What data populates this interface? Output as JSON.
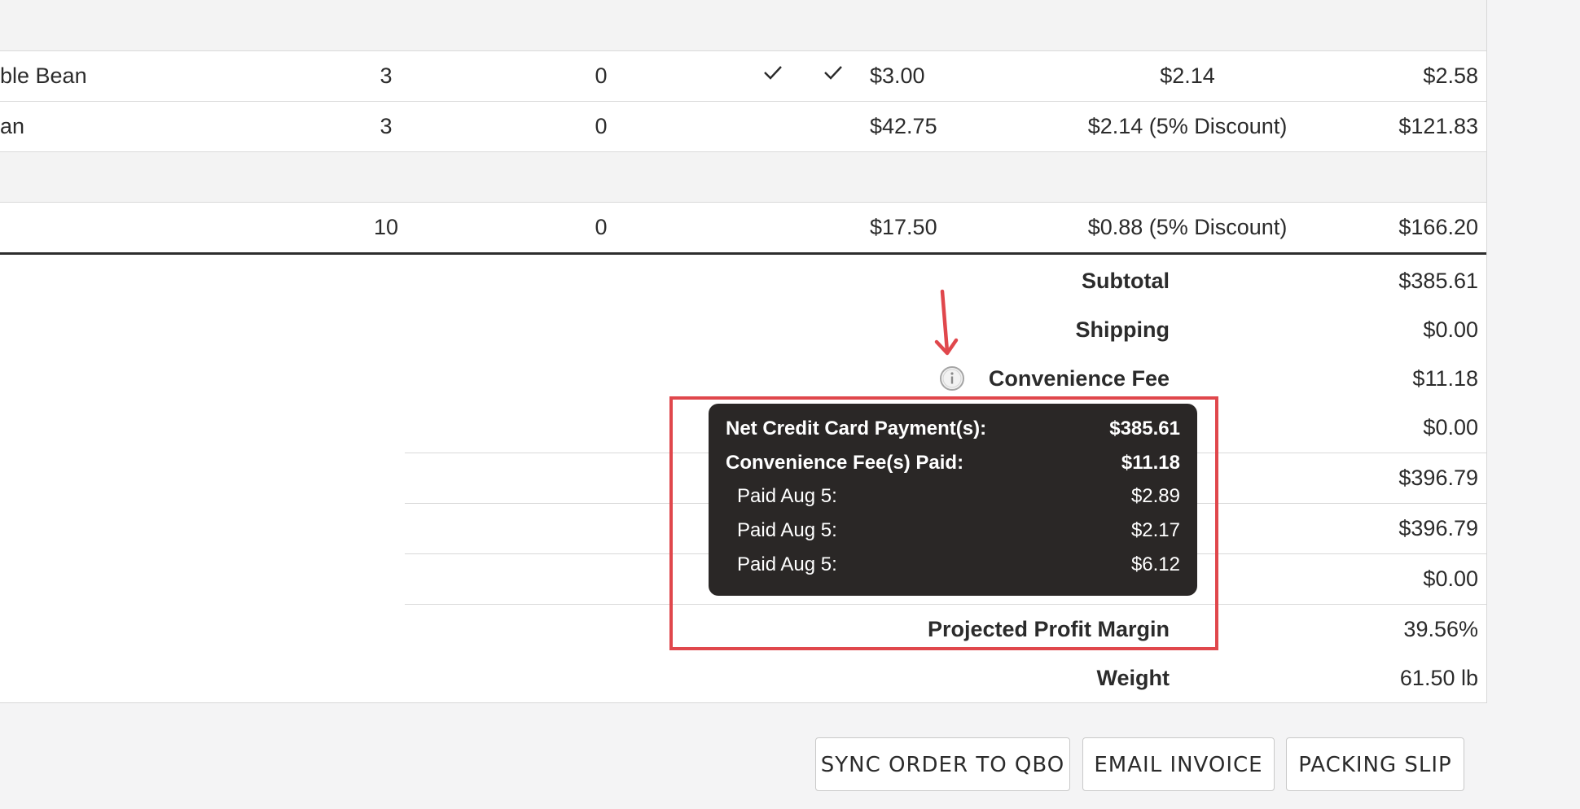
{
  "rows": [
    {
      "name": "ble Bean",
      "qty": "3",
      "backorder": "0",
      "price": "$3.00",
      "cost": "$2.14",
      "total": "$2.58"
    },
    {
      "name": "an",
      "qty": "3",
      "backorder": "0",
      "price": "$42.75",
      "cost": "$2.14 (5% Discount)",
      "total": "$121.83"
    },
    {
      "name": "",
      "qty": "10",
      "backorder": "0",
      "price": "$17.50",
      "cost": "$0.88 (5% Discount)",
      "total": "$166.20"
    }
  ],
  "summary": {
    "subtotal_label": "Subtotal",
    "subtotal_value": "$385.61",
    "shipping_label": "Shipping",
    "shipping_value": "$0.00",
    "fee_label": "Convenience Fee",
    "fee_value": "$11.18",
    "row4_value": "$0.00",
    "row5_value": "$396.79",
    "row6_value": "$396.79",
    "row7_value": "$0.00",
    "margin_label": "Projected Profit Margin",
    "margin_value": "39.56%",
    "weight_label": "Weight",
    "weight_value": "61.50 lb"
  },
  "tooltip": {
    "net_label": "Net Credit Card Payment(s):",
    "net_value": "$385.61",
    "fees_label": "Convenience Fee(s) Paid:",
    "fees_value": "$11.18",
    "payments": [
      {
        "label": "Paid Aug 5:",
        "value": "$2.89"
      },
      {
        "label": "Paid Aug 5:",
        "value": "$2.17"
      },
      {
        "label": "Paid Aug 5:",
        "value": "$6.12"
      }
    ]
  },
  "buttons": {
    "sync": "SYNC ORDER TO QBO",
    "email": "EMAIL INVOICE",
    "packing": "PACKING SLIP"
  },
  "colors": {
    "annotation_red": "#e0474c",
    "tooltip_bg": "#2a2726"
  },
  "icons": [
    "check-icon",
    "info-icon",
    "red-arrow-annotation"
  ]
}
